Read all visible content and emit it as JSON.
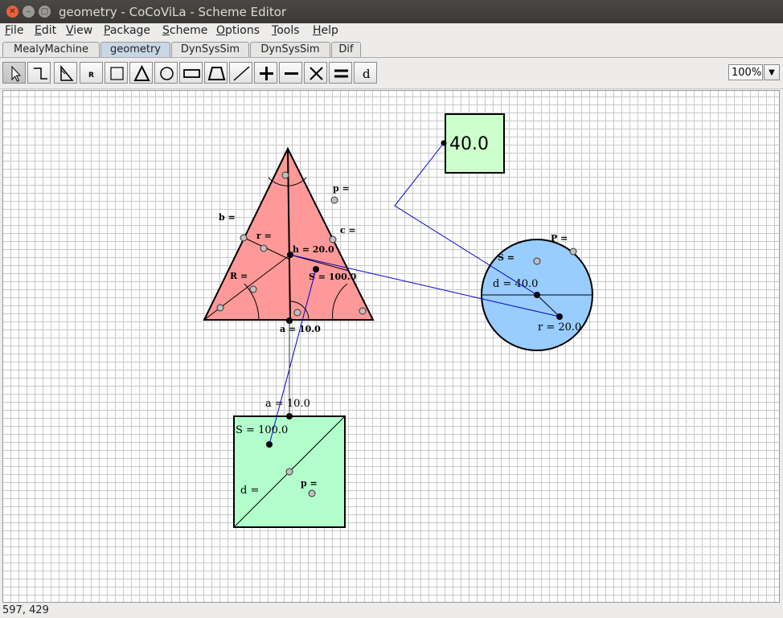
{
  "window": {
    "title": "geometry - CoCoViLa - Scheme Editor"
  },
  "menu": [
    "File",
    "Edit",
    "View",
    "Package",
    "Scheme",
    "Options",
    "Tools",
    "Help"
  ],
  "tabs": [
    "MealyMachine",
    "geometry",
    "DynSysSim",
    "DynSysSim",
    "Dif"
  ],
  "active_tab": "geometry",
  "toolbar": {
    "tools": [
      "select-arrow-icon",
      "connector-icon",
      "right-triangle-icon",
      "r-icon",
      "rectangle-icon",
      "triangle-icon",
      "circle-icon",
      "wide-rectangle-icon",
      "trapezoid-icon",
      "line-icon",
      "plus-icon",
      "minus-icon",
      "multiply-icon",
      "equals-icon",
      "d-icon"
    ],
    "r_glyph": "R",
    "d_glyph": "d"
  },
  "zoom": {
    "value": "100%"
  },
  "scheme": {
    "output_box": {
      "value": "40.0",
      "fill": "#ccffcc"
    },
    "triangle": {
      "fill": "#ff9999",
      "labels": {
        "p": "p =",
        "b": "b =",
        "c": "c =",
        "r": "r =",
        "h": "h = 20.0",
        "R": "R =",
        "S": "S = 100.0",
        "a": "a = 10.0"
      }
    },
    "circle": {
      "fill": "#99ccff",
      "labels": {
        "P": "P =",
        "S": "S =",
        "d": "d = 40.0",
        "r": "r = 20.0"
      }
    },
    "square": {
      "fill": "#b3ffcc",
      "labels": {
        "a": "a = 10.0",
        "S": "S = 100.0",
        "d": "d =",
        "p": "p ="
      }
    },
    "connection_color": "#0000cc"
  },
  "status": {
    "coords": "597, 429"
  }
}
